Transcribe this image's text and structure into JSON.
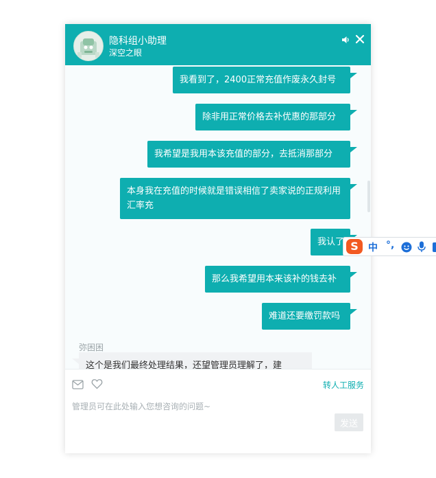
{
  "header": {
    "title": "隐科组小助理",
    "subtitle": "深空之眼"
  },
  "messages": [
    {
      "sender": "user",
      "text": "我看到了，2400正常充值作废永久封号"
    },
    {
      "sender": "user",
      "text": "除非用正常价格去补优惠的那部分"
    },
    {
      "sender": "user",
      "text": "我希望是我用本该充值的部分，去抵消那部分"
    },
    {
      "sender": "user",
      "text": "本身我在充值的时候就是错误相信了卖家说的正规利用汇率充"
    },
    {
      "sender": "user",
      "text": "我认了"
    },
    {
      "sender": "user",
      "text": "那么我希望用本来该补的钱去补"
    },
    {
      "sender": "user",
      "text": "难道还要缴罚款吗"
    },
    {
      "sender": "agent",
      "name": "弥困困",
      "text": "这个是我们最终处理结果，还望管理员理解了，建"
    }
  ],
  "footer": {
    "transfer_label": "转人工服务",
    "input_placeholder": "管理员可在此处输入您想咨询的问题~",
    "send_label": "发送"
  },
  "ime": {
    "logo": "S",
    "lang": "中",
    "punct": "°,"
  },
  "colors": {
    "accent": "#0eaeb0",
    "agent_bubble": "#f0f2f4",
    "ime_logo": "#f25a22",
    "ime_blue": "#1d6fd8"
  },
  "icons": {
    "header": [
      "avatar",
      "speaker-icon",
      "close-icon"
    ],
    "footer": [
      "mail-icon",
      "heart-icon"
    ],
    "ime": [
      "sogou-logo-icon",
      "emoji-icon",
      "microphone-icon"
    ]
  }
}
